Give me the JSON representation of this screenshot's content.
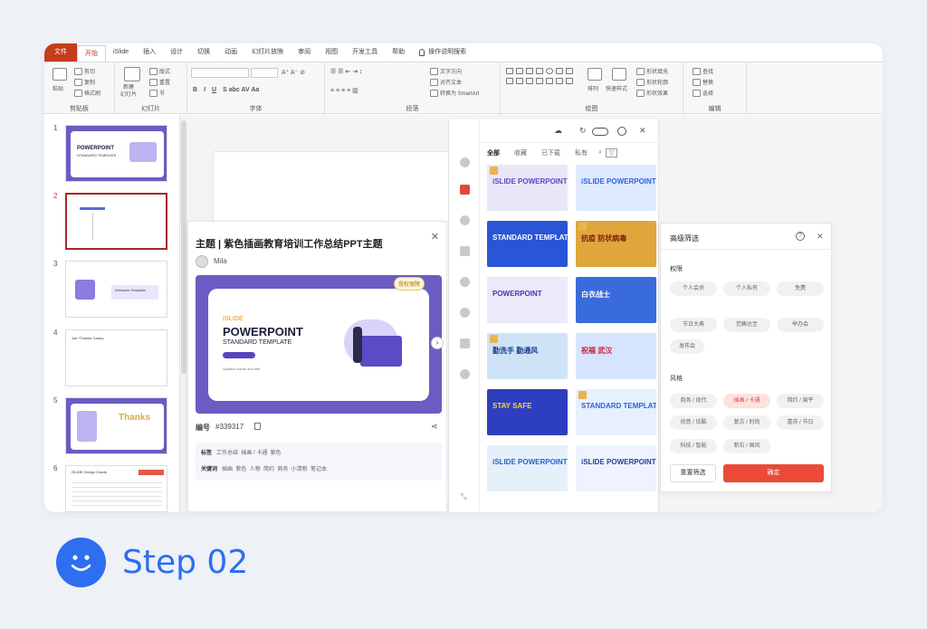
{
  "ribbon": {
    "tabs": [
      "文件",
      "开始",
      "iSlide",
      "插入",
      "设计",
      "切换",
      "动画",
      "幻灯片放映",
      "审阅",
      "视图",
      "开发工具",
      "帮助"
    ],
    "search": "操作说明搜索",
    "clipboard": {
      "paste": "粘贴",
      "cut": "剪切",
      "copy": "复制",
      "format_painter": "格式刷",
      "label": "剪贴板"
    },
    "slides": {
      "new_slide": "新建\n幻灯片",
      "layout": "版式",
      "reset": "重置",
      "section": "节",
      "label": "幻灯片"
    },
    "font": {
      "label": "字体"
    },
    "paragraph": {
      "text_direction": "文字方向",
      "align_text": "对齐文本",
      "smartart": "转换为 SmartArt",
      "label": "段落"
    },
    "drawing": {
      "arrange": "排列",
      "quick_styles": "快速样式",
      "fill": "形状填充",
      "outline": "形状轮廓",
      "effects": "形状效果",
      "label": "绘图"
    },
    "editing": {
      "find": "查找",
      "replace": "替换",
      "select": "选择",
      "label": "编辑"
    }
  },
  "slides_panel": {
    "numbers": [
      "1",
      "2",
      "3",
      "4",
      "5",
      "6"
    ]
  },
  "thumb_text": {
    "s1_title": "POWERPOINT",
    "s1_sub": "STANDARD TEMPLATE",
    "s3_title": "Welcome Template",
    "s4_title": "Joe *Thanks *Lasso",
    "s5_title": "Thanks",
    "s6_title": "iSLIDE Design Charts"
  },
  "preview": {
    "title": "主题 | 紫色插画教育培训工作总结PPT主题",
    "author": "Mila",
    "auth_badge": "授权保障",
    "brand": "iSLIDE",
    "hero_title": "POWERPOINT",
    "hero_sub": "STANDARD TEMPLATE",
    "hero_btn": "Speaker name and title",
    "code_label": "编号",
    "code_value": "#339317",
    "tags_label": "标签",
    "tags": "工作总结  插画 / 卡通  紫色",
    "keywords_label": "关键词",
    "keywords": "插画  紫色  人物  简约  商务  小清新  笔记本"
  },
  "gallery": {
    "filters": [
      "全部",
      "收藏",
      "已下载",
      "私有"
    ],
    "templates": [
      {
        "text": "iSLIDE POWERPOINT",
        "bg": "#e8e6f7",
        "fg": "#5b4bc4"
      },
      {
        "text": "iSLIDE POWERPOINT",
        "bg": "#dfe9ff",
        "fg": "#2e63d9"
      },
      {
        "text": "STANDARD TEMPLATE",
        "bg": "#2a55d6",
        "fg": "#ffffff"
      },
      {
        "text": "抗疫 防状病毒",
        "bg": "#e0a63b",
        "fg": "#7a1f0f"
      },
      {
        "text": "POWERPOINT",
        "bg": "#ece9fb",
        "fg": "#4736b0"
      },
      {
        "text": "白衣战士",
        "bg": "#3a6bdc",
        "fg": "#ffffff"
      },
      {
        "text": "勤洗手 勤通风",
        "bg": "#cfe3f7",
        "fg": "#123c8c"
      },
      {
        "text": "祝福 武汉",
        "bg": "#d6e4ff",
        "fg": "#c8223a"
      },
      {
        "text": "STAY SAFE",
        "bg": "#2d3fbf",
        "fg": "#ffd23a"
      },
      {
        "text": "STANDARD TEMPLATE",
        "bg": "#e7f0ff",
        "fg": "#2d62d8"
      },
      {
        "text": "iSLIDE POWERPOINT",
        "bg": "#e6f0fb",
        "fg": "#2563c9"
      },
      {
        "text": "iSLIDE POWERPOINT",
        "bg": "#eef3ff",
        "fg": "#2a3f97"
      }
    ]
  },
  "advanced": {
    "title": "高级筛选",
    "rights_label": "权限",
    "rights": [
      "个人会员",
      "个人私有",
      "免费",
      "节日大典",
      "范畴达至",
      "举办会",
      "发布会"
    ],
    "style_label": "风格",
    "styles": [
      "商务 / 现代",
      "插画 / 卡通",
      "简约 / 扁平",
      "创意 / 炫酷",
      "复古 / 时尚",
      "喜庆 / 节日",
      "科技 / 智能",
      "新石 / 国风"
    ],
    "reset": "重置筛选",
    "ok": "确定"
  },
  "step": {
    "label": "Step 02"
  },
  "colors": {
    "accent": "#c43d1e",
    "primary": "#2e6ef0",
    "danger": "#ea4a36",
    "purple": "#6a5cc3"
  }
}
